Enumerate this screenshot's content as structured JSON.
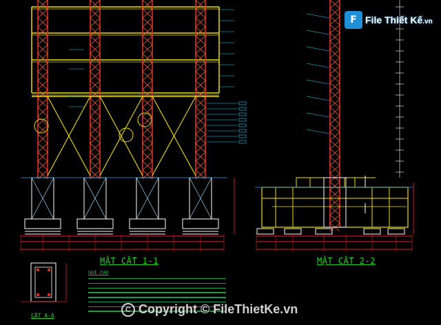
{
  "watermark_logo": {
    "mark": "F",
    "text": "File Thiết Kế",
    "suffix": ".vn"
  },
  "titles": {
    "section_1": "MẶT CẮT 1-1",
    "section_2": "MẶT CẮT 2-2",
    "notes": "GHI CHÚ",
    "cut_aa": "CẮT A-A"
  },
  "copyright": "Copyright © FileThietKe.vn",
  "colors": {
    "frame": "#f0e000",
    "columns": "#e03020",
    "columns_highlight": "#ff6040",
    "footings": "#ffffff",
    "dimension": "#e02020",
    "labels": "#30d0ff",
    "notes": "#28d028",
    "grid_bg": "#000000"
  }
}
